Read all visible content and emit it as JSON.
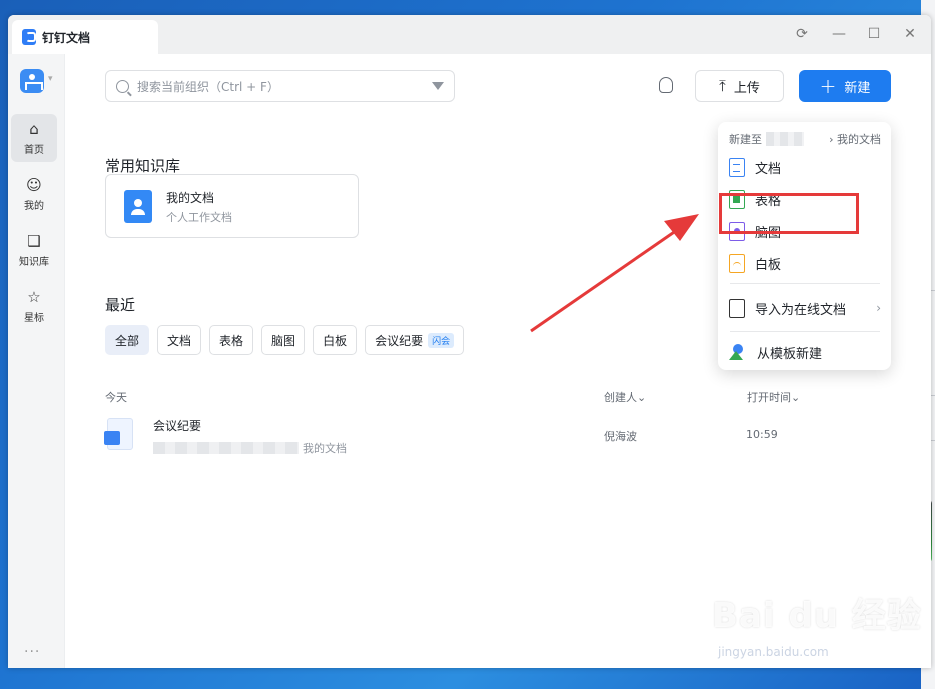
{
  "window": {
    "tab_title": "钉钉文档",
    "controls": {
      "sync": "⟳",
      "minimize": "—",
      "maximize": "☐",
      "close": "✕"
    }
  },
  "sidebar": {
    "items": [
      {
        "label": "首页",
        "icon": "home-icon",
        "glyph": "⌂",
        "active": true
      },
      {
        "label": "我的",
        "icon": "profile-icon",
        "glyph": "☺",
        "active": false
      },
      {
        "label": "知识库",
        "icon": "book-icon",
        "glyph": "❑",
        "active": false
      },
      {
        "label": "星标",
        "icon": "star-icon",
        "glyph": "☆",
        "active": false
      }
    ],
    "more": "···"
  },
  "toolbar": {
    "search_placeholder": "搜索当前组织（Ctrl + F）",
    "upload_label": "上传",
    "upload_glyph": "⤒",
    "new_label": "新建",
    "new_glyph": "+"
  },
  "knowledge": {
    "section_title": "常用知识库",
    "card": {
      "name": "我的文档",
      "subtitle": "个人工作文档"
    }
  },
  "recent": {
    "section_title": "最近",
    "filters": [
      {
        "label": "全部",
        "active": true
      },
      {
        "label": "文档"
      },
      {
        "label": "表格"
      },
      {
        "label": "脑图"
      },
      {
        "label": "白板"
      },
      {
        "label": "会议纪要",
        "badge": "闪会"
      }
    ],
    "columns": {
      "group": "今天",
      "creator": "创建人⌄",
      "opened": "打开时间⌄"
    },
    "rows": [
      {
        "name": "会议纪要",
        "path_suffix": "我的文档",
        "creator": "倪海波",
        "time": "10:59"
      }
    ]
  },
  "new_menu": {
    "header_prefix": "新建至",
    "header_target": "› 我的文档",
    "items": [
      {
        "label": "文档",
        "icon": "doc-icon"
      },
      {
        "label": "表格",
        "icon": "sheet-icon"
      },
      {
        "label": "脑图",
        "icon": "mindmap-icon",
        "highlighted": true
      },
      {
        "label": "白板",
        "icon": "whiteboard-icon"
      }
    ],
    "import_label": "导入为在线文档",
    "template_label": "从模板新建",
    "chevron": "›"
  },
  "annotation": {
    "highlight_color": "#e53a3a"
  },
  "watermark": {
    "logo": "Bai du 经验",
    "url": "jingyan.baidu.com"
  },
  "colors": {
    "accent": "#1e7cf0",
    "sidebar_bg": "#f4f5f6"
  }
}
